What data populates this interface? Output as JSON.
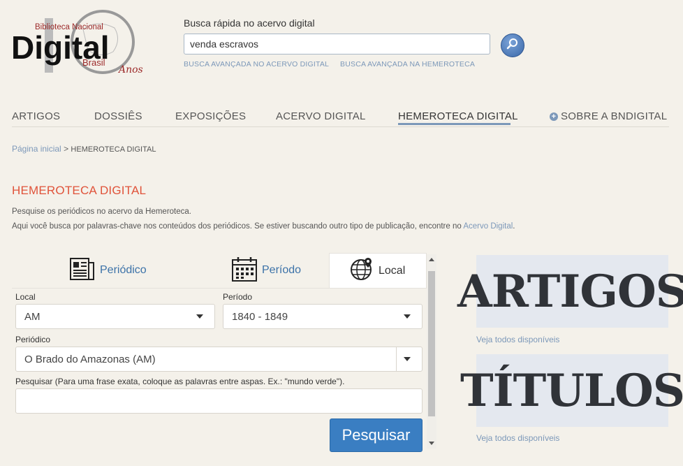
{
  "logo": {
    "top_text": "Biblioteca Nacional",
    "main_text": "Digital",
    "sub_text": "Brasil",
    "number": "10",
    "anos": "Anos"
  },
  "search": {
    "title": "Busca rápida no acervo digital",
    "value": "venda escravos",
    "advanced_acervo": "BUSCA AVANÇADA NO ACERVO DIGITAL",
    "advanced_hemeroteca": "BUSCA AVANÇADA NA HEMEROTECA"
  },
  "nav": {
    "items": [
      "ARTIGOS",
      "DOSSIÊS",
      "EXPOSIÇÕES",
      "ACERVO DIGITAL",
      "HEMEROTECA DIGITAL",
      "SOBRE A BNDIGITAL"
    ]
  },
  "breadcrumb": {
    "home": "Página inicial",
    "separator": ">",
    "current": "HEMEROTECA DIGITAL"
  },
  "page": {
    "title": "HEMEROTECA DIGITAL",
    "line1": "Pesquise os periódicos no acervo da Hemeroteca.",
    "line2_prefix": "Aqui você busca por palavras-chave nos conteúdos dos periódicos. Se estiver buscando outro tipo de publicação, encontre no ",
    "line2_link": "Acervo Digital",
    "line2_suffix": "."
  },
  "tabs": {
    "periodico": "Periódico",
    "periodo": "Período",
    "local": "Local"
  },
  "form": {
    "local_label": "Local",
    "local_value": "AM",
    "periodo_label": "Período",
    "periodo_value": "1840 - 1849",
    "periodico_label": "Periódico",
    "periodico_value": "O Brado do Amazonas (AM)",
    "pesquisar_label": "Pesquisar (Para uma frase exata, coloque as palavras entre aspas. Ex.: \"mundo verde\").",
    "pesquisar_value": "",
    "submit": "Pesquisar"
  },
  "banners": {
    "artigos": "ARTIGOS",
    "artigos_link": "Veja todos disponíveis",
    "titulos": "TÍTULOS",
    "titulos_link": "Veja todos disponíveis"
  },
  "colors": {
    "background": "#f4f1ea",
    "link": "#7c98b9",
    "title_red": "#e0533a",
    "button_blue": "#3a7ec2",
    "logo_red": "#9c2a2a"
  }
}
